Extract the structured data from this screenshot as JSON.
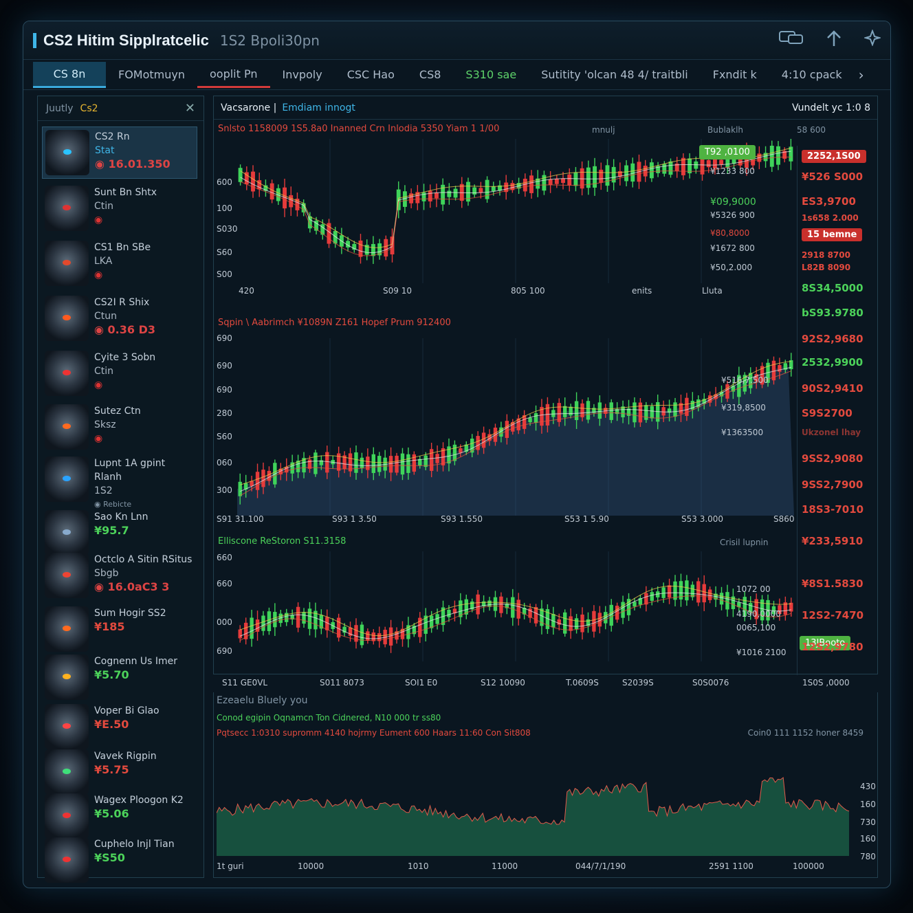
{
  "window": {
    "title": "CS2 Hitim Sipplratcelic",
    "subtitle": "1S2 Bpoli30pn"
  },
  "tabs": [
    {
      "label": "CS 8n",
      "active": true
    },
    {
      "label": "FOMotmuyn"
    },
    {
      "label": "ooplit Pn"
    },
    {
      "label": "Invpoly"
    },
    {
      "label": "CSC Hao"
    },
    {
      "label": "CS8"
    },
    {
      "label": "S310 sae"
    },
    {
      "label": "Sutitity 'olcan 48 4/ traitbli"
    },
    {
      "label": "Fxndit k"
    },
    {
      "label": "4:10 cpack"
    }
  ],
  "sidebar": {
    "header_label": "Juutly",
    "header_tag": "Cs2",
    "items": [
      {
        "name": "CS2 Rn",
        "line2": "Stat",
        "price": "16.01.350",
        "eye": "#2ac3ff"
      },
      {
        "name": "Sunt Bn Shtx",
        "line2": "Ctin",
        "price": "",
        "eye": "#d33"
      },
      {
        "name": "CS1 Bn SBe",
        "line2": "LKA",
        "price": "",
        "eye": "#e2492c"
      },
      {
        "name": "CS2I R Shix",
        "line2": "Ctun",
        "price": "0.36 D3",
        "eye": "#ff5a1f"
      },
      {
        "name": "Cyite 3 Sobn",
        "line2": "Ctin",
        "price": "",
        "eye": "#e33"
      },
      {
        "name": "Sutez Ctn",
        "line2": "Sksz",
        "price": "",
        "eye": "#ff6a1f"
      },
      {
        "name": "Lupnt 1A gpint Rlanh",
        "line2": "1S2",
        "price": "Rebicte",
        "eye": "#2aa3ff"
      },
      {
        "name": "Sao Kn Lnn",
        "line2": "",
        "price": "¥95.7",
        "eye": "#8ac"
      },
      {
        "name": "Octclo A Sitin RSitus",
        "line2": "Sbgb",
        "price": "16.0aC3 3",
        "eye": "#e43"
      },
      {
        "name": "Sum Hogir SS2",
        "line2": "",
        "price": "¥185",
        "eye": "#ff6a1f"
      },
      {
        "name": "Cognenn Us Imer",
        "line2": "",
        "price": "¥5.70",
        "eye": "#ffb21f"
      },
      {
        "name": "Voper Bi Glao",
        "line2": "",
        "price": "¥E.50",
        "eye": "#f44"
      },
      {
        "name": "Vavek Rigpin",
        "line2": "",
        "price": "¥5.75",
        "eye": "#3fe07a"
      },
      {
        "name": "Wagex Ploogon K2",
        "line2": "",
        "price": "¥5.06",
        "eye": "#e33"
      },
      {
        "name": "Cuphelo Injl Tian",
        "line2": "",
        "price": "¥S50",
        "eye": "#e33"
      }
    ]
  },
  "main": {
    "panel_title": "Vacsarone |",
    "panel_subtitle": "Emdiam innogt",
    "panel_right": "Vundelt yc 1:0 8",
    "top_stats": "Snlsto  1158009 1S5.8a0  Inanned Crn  Inlodia 5350  Yiam 1 1/00",
    "top_mid": "mnulj",
    "top_col1": "Bublaklh",
    "top_col2": "58 600",
    "chart1_yticks": [
      "600",
      "100",
      "S030",
      "S60",
      "S00"
    ],
    "chart1_xticks": [
      "420",
      "S09 10",
      "805 100",
      "enits",
      "Lluta"
    ],
    "chart1_tag": "T92 ,0100",
    "chart1_labels": [
      "¥1233 800",
      "¥09,9000",
      "¥5326 900",
      "¥80,8000",
      "¥1672 800",
      "¥50,2.000"
    ],
    "chart2_stats": "Sqpin \\ Aabrimch  ¥1089N  Z161  Hopef Prum 912400",
    "chart2_yticks": [
      "690",
      "690",
      "690",
      "280",
      "S60",
      "060",
      "300"
    ],
    "chart2_xticks": [
      "S91 31.100",
      "S93 1 3.50",
      "S93 1.550",
      "S53 1 5.90",
      "S53 3.000",
      "S860"
    ],
    "chart2_labels": [
      "¥516,7.500",
      "¥319,8500",
      "¥1363500"
    ],
    "chart3_stats": "Elliscone  ReStoron  S11.3158",
    "chart3_right_label": "Crisil lupnin",
    "chart3_yticks": [
      "660",
      "660",
      "000",
      "690"
    ],
    "chart3_xticks": [
      "S11 GE0VL",
      "S011 8073",
      "SOI1 E0",
      "S12 10090",
      "T.0609S",
      "S2039S",
      "S0S0076",
      "1S0S ,0000"
    ],
    "chart3_tag": "13JBooto",
    "chart3_labels": [
      "1072 00",
      "4190,0000",
      "0065,100",
      "¥1016 2100"
    ],
    "right_prices": [
      {
        "v": "2252,1S00",
        "c": "#e34a3e",
        "badge": true
      },
      {
        "v": "¥526 S000",
        "c": "#e34a3e"
      },
      {
        "v": "ES3,9700",
        "c": "#e34a3e"
      },
      {
        "v": "1s658 2.000",
        "c": "#e34a3e"
      },
      {
        "v": "15 bemne",
        "c": "#e34a3e",
        "badge": true
      },
      {
        "v": "2918 8700",
        "c": "#e34a3e"
      },
      {
        "v": "L82B 8090",
        "c": "#e34a3e"
      },
      {
        "v": "8S34,5000",
        "c": "#4cd25a"
      },
      {
        "v": "bS93.9780",
        "c": "#4cd25a"
      },
      {
        "v": "92S2,9680",
        "c": "#e34a3e"
      },
      {
        "v": "2532,9900",
        "c": "#4cd25a"
      },
      {
        "v": "90S2,9410",
        "c": "#e34a3e"
      },
      {
        "v": "S9S2700",
        "c": "#e34a3e"
      },
      {
        "v": "Ukzonel lhay",
        "c": "#e34a3e"
      },
      {
        "v": "9SS2,9080",
        "c": "#e34a3e"
      },
      {
        "v": "9SS2,7900",
        "c": "#e34a3e"
      },
      {
        "v": "18S3-7010",
        "c": "#e34a3e"
      },
      {
        "v": "¥233,5910",
        "c": "#e34a3e"
      },
      {
        "v": "¥8S1.5830",
        "c": "#e34a3e"
      },
      {
        "v": "12S2-7470",
        "c": "#e34a3e"
      },
      {
        "v": "12S2,9780",
        "c": "#e34a3e"
      }
    ],
    "depth_title": "Ezeaelu Bluely you",
    "depth_stats1": "Conod egipin  Oqnamcn Ton  Cidnered, N10 000  tr ss80",
    "depth_stats2": "Pqtsecc 1:0310  supromm 4140  hojrmy  Eument  600  Haars 11:60  Con Sit808",
    "depth_right": "Coin0 111 1152  honer  8459",
    "depth_yticks": [
      "430",
      "160",
      "730",
      "160",
      "780"
    ],
    "depth_xticks": [
      "1t guri",
      "10000",
      "1010",
      "11000",
      "044/7/1/190",
      "2591 1100",
      "100000"
    ]
  },
  "colors": {
    "up": "#3fd45a",
    "down": "#e53b3b",
    "accent": "#3fb6e8",
    "bg": "#0a1620"
  }
}
